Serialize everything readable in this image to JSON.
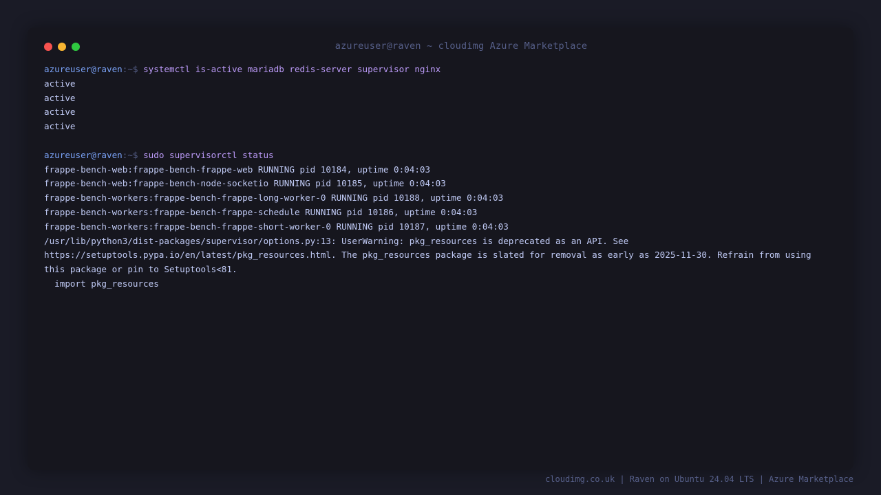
{
  "window": {
    "title": "azureuser@raven ~ cloudimg Azure Marketplace",
    "controls": {
      "close_color": "#f7524f",
      "minimize_color": "#f8b532",
      "maximize_color": "#2fc840"
    }
  },
  "terminal": {
    "prompt_user": "azureuser@raven",
    "prompt_path": ":~$ ",
    "colors": {
      "user": "#7aa2f7",
      "path": "#565f89",
      "command": "#bb9af7",
      "output": "#c0caf5"
    },
    "blocks": [
      {
        "command": "systemctl is-active mariadb redis-server supervisor nginx",
        "output": [
          "active",
          "active",
          "active",
          "active"
        ]
      },
      {
        "command": "sudo supervisorctl status",
        "output": [
          "frappe-bench-web:frappe-bench-frappe-web RUNNING pid 10184, uptime 0:04:03",
          "frappe-bench-web:frappe-bench-node-socketio RUNNING pid 10185, uptime 0:04:03",
          "frappe-bench-workers:frappe-bench-frappe-long-worker-0 RUNNING pid 10188, uptime 0:04:03",
          "frappe-bench-workers:frappe-bench-frappe-schedule RUNNING pid 10186, uptime 0:04:03",
          "frappe-bench-workers:frappe-bench-frappe-short-worker-0 RUNNING pid 10187, uptime 0:04:03",
          "/usr/lib/python3/dist-packages/supervisor/options.py:13: UserWarning: pkg_resources is deprecated as an API. See",
          "https://setuptools.pypa.io/en/latest/pkg_resources.html. The pkg_resources package is slated for removal as early as 2025-11-30. Refrain from using",
          "this package or pin to Setuptools<81.",
          "  import pkg_resources"
        ]
      }
    ]
  },
  "footer": {
    "text": "cloudimg.co.uk | Raven on Ubuntu 24.04 LTS | Azure Marketplace"
  }
}
